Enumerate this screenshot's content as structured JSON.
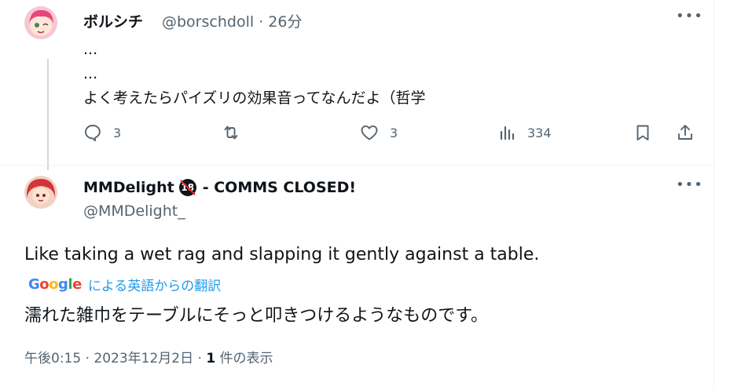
{
  "parent": {
    "display_name": "ボルシチ",
    "handle": "@borschdoll",
    "separator": "·",
    "time": "26分",
    "lines": [
      "...",
      "...",
      "よく考えたらパイズリの効果音ってなんだよ（哲学"
    ],
    "actions": {
      "reply_count": "3",
      "like_count": "3",
      "views_count": "334"
    }
  },
  "focused": {
    "display_name": "MMDelight",
    "badge": "18",
    "name_suffix": " - COMMS CLOSED!",
    "handle": "@MMDelight_",
    "text_en": "Like taking a wet rag and slapping it gently against a table.",
    "translate_logo": "Google",
    "translate_label": "による英語からの翻訳",
    "text_ja": "濡れた雑巾をテーブルにそっと叩きつけるようなものです。",
    "footer_time": "午後0:15 · 2023年12月2日 · ",
    "footer_count": "1",
    "footer_suffix": " 件の表示"
  },
  "colors": {
    "text": "#0f1419",
    "muted": "#536471",
    "link": "#1d9bf0",
    "line": "#cfd9de"
  }
}
